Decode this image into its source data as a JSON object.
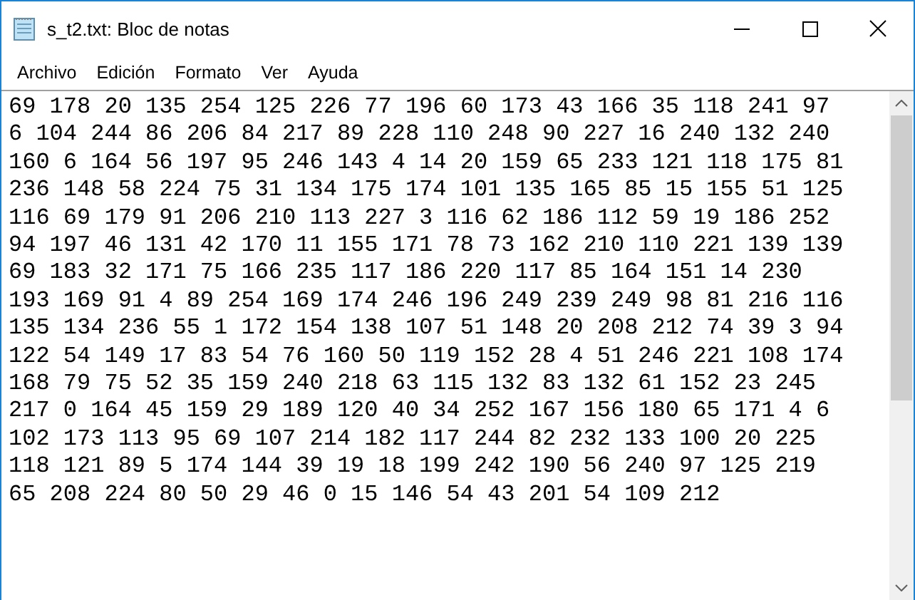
{
  "window": {
    "title": "s_t2.txt: Bloc de notas"
  },
  "menu": [
    "Archivo",
    "Edición",
    "Formato",
    "Ver",
    "Ayuda"
  ],
  "editor": {
    "lines": [
      "69 178 20 135 254 125 226 77 196 60 173 43 166 35 118 241 97",
      "6 104 244 86 206 84 217 89 228 110 248 90 227 16 240 132 240",
      "160 6 164 56 197 95 246 143 4 14 20 159 65 233 121 118 175 81",
      "236 148 58 224 75 31 134 175 174 101 135 165 85 15 155 51 125",
      "116 69 179 91 206 210 113 227 3 116 62 186 112 59 19 186 252",
      "94 197 46 131 42 170 11 155 171 78 73 162 210 110 221 139 139",
      "69 183 32 171 75 166 235 117 186 220 117 85 164 151 14 230",
      "193 169 91 4 89 254 169 174 246 196 249 239 249 98 81 216 116",
      "135 134 236 55 1 172 154 138 107 51 148 20 208 212 74 39 3 94",
      "122 54 149 17 83 54 76 160 50 119 152 28 4 51 246 221 108 174",
      "168 79 75 52 35 159 240 218 63 115 132 83 132 61 152 23 245",
      "217 0 164 45 159 29 189 120 40 34 252 167 156 180 65 171 4 6",
      "102 173 113 95 69 107 214 182 117 244 82 232 133 100 20 225",
      "118 121 89 5 174 144 39 19 18 199 242 190 56 240 97 125 219",
      "65 208 224 80 50 29 46 0 15 146 54 43 201 54 109 212"
    ]
  }
}
